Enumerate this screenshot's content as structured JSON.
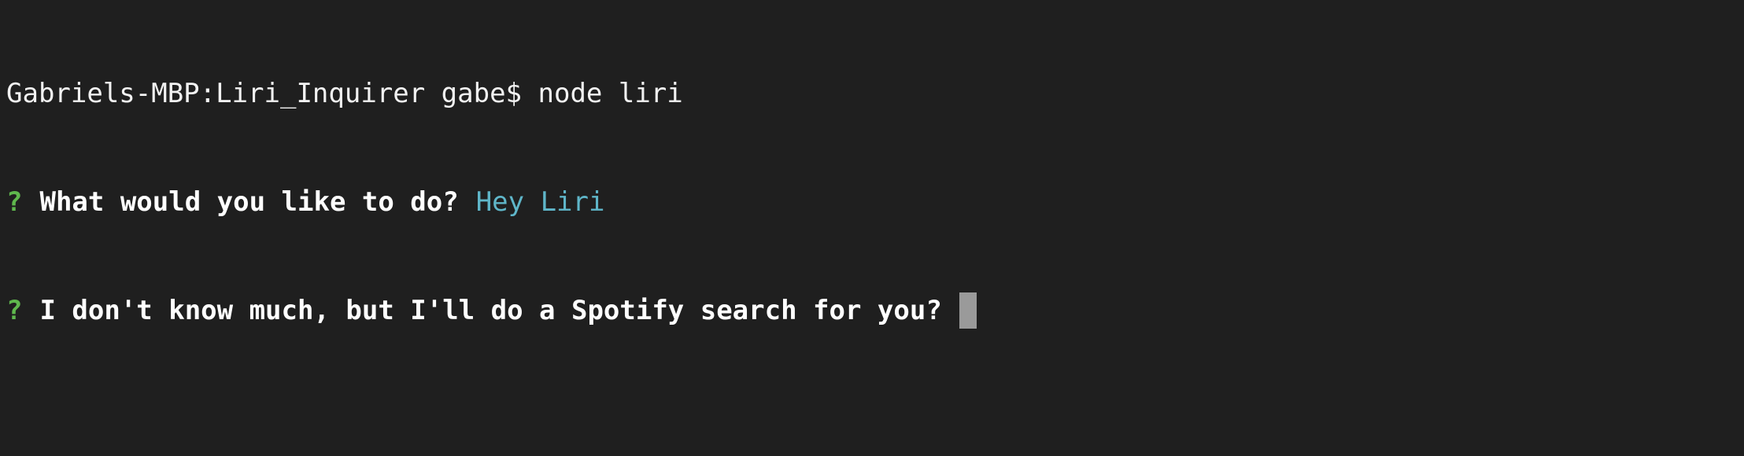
{
  "terminal": {
    "line1": {
      "prompt": "Gabriels-MBP:Liri_Inquirer gabe$ ",
      "command": "node liri"
    },
    "line2": {
      "marker": "?",
      "question": "What would you like to do?",
      "answer": "Hey Liri"
    },
    "line3": {
      "marker": "?",
      "question": "I don't know much, but I'll do a Spotify search for you?"
    }
  },
  "colors": {
    "background": "#1f1f1f",
    "marker": "#5fb84d",
    "answer": "#5fb6c9",
    "cursor": "#9a9a9a"
  }
}
